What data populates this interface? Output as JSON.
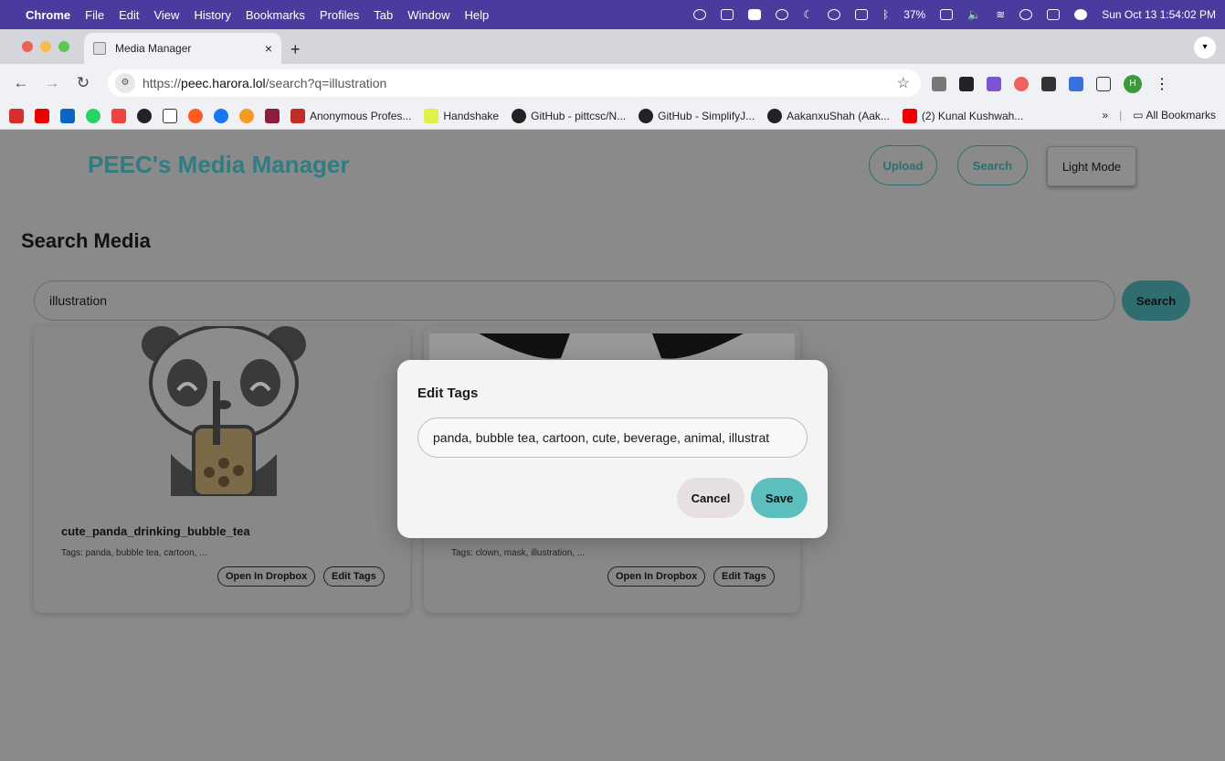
{
  "menubar": {
    "apple": "",
    "app": "Chrome",
    "items": [
      "File",
      "Edit",
      "View",
      "History",
      "Bookmarks",
      "Profiles",
      "Tab",
      "Window",
      "Help"
    ],
    "battery": "37%",
    "clock": "Sun Oct 13  1:54:02 PM"
  },
  "tab": {
    "title": "Media Manager",
    "close": "×",
    "new": "+"
  },
  "address": {
    "scheme": "https://",
    "host": "peec.harora.lol",
    "path": "/search?q=illustration",
    "star": "☆"
  },
  "bookmarks": {
    "items": [
      "Anonymous Profes...",
      "Handshake",
      "GitHub - pittcsc/N...",
      "GitHub - SimplifyJ...",
      "AakanxuShah (Aak...",
      "(2) Kunal Kushwah..."
    ],
    "more": "»",
    "all": "All Bookmarks"
  },
  "header": {
    "brand": "PEEC's Media Manager",
    "upload": "Upload",
    "search": "Search",
    "light_mode": "Light Mode"
  },
  "search": {
    "heading": "Search Media",
    "query": "illustration",
    "button": "Search"
  },
  "cards": [
    {
      "filename": "cute_panda_drinking_bubble_tea",
      "tags": "Tags: panda, bubble tea, cartoon, ...",
      "open": "Open In Dropbox",
      "edit": "Edit Tags"
    },
    {
      "filename": "",
      "tags": "Tags: clown, mask, illustration, ...",
      "open": "Open In Dropbox",
      "edit": "Edit Tags"
    }
  ],
  "modal": {
    "title": "Edit Tags",
    "tags_value": "panda, bubble tea, cartoon, cute, beverage, animal, illustrat",
    "cancel": "Cancel",
    "save": "Save"
  },
  "colors": {
    "brand": "#2d7d82",
    "save": "#5cbfbd",
    "menubar": "#4a3b9e"
  }
}
